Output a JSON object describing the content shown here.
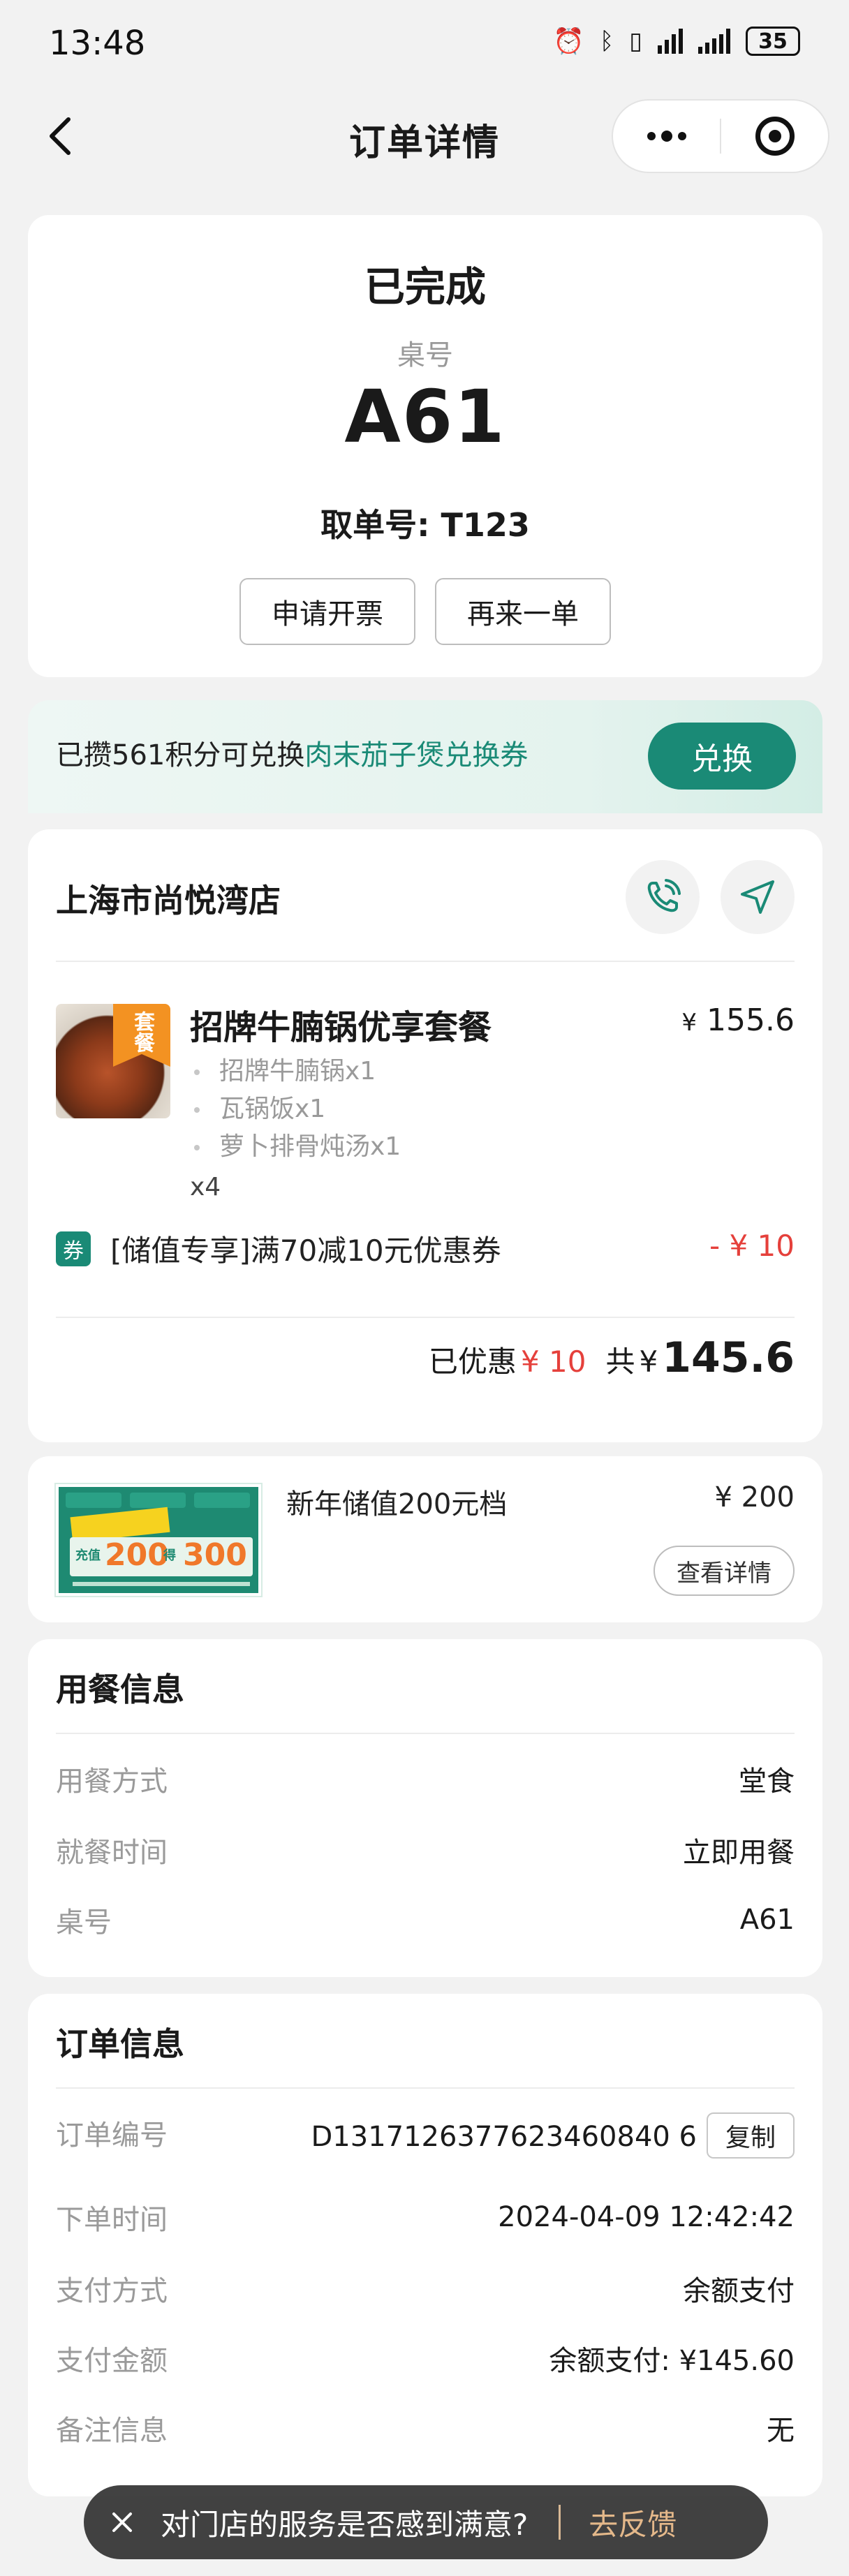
{
  "status_bar": {
    "time": "13:48",
    "battery": "35"
  },
  "nav": {
    "title": "订单详情"
  },
  "order_status": {
    "title": "已完成",
    "table_label": "桌号",
    "table_number": "A61",
    "pickup": "取单号: T123",
    "buttons": [
      "申请开票",
      "再来一单"
    ]
  },
  "points": {
    "prefix": "已攒561积分可兑换",
    "highlight": "肉末茄子煲兑换券",
    "button": "兑换"
  },
  "store": {
    "name": "上海市尚悦湾店",
    "item": {
      "badge": "套餐",
      "name": "招牌牛腩锅优享套餐",
      "currency": "¥",
      "price": "155.6",
      "sub_items": [
        "招牌牛腩锅x1",
        "瓦锅饭x1",
        "萝卜排骨炖汤x1"
      ],
      "quantity": "x4"
    },
    "coupon": {
      "tag": "券",
      "name": "[储值专享]满70减10元优惠券",
      "amount": "- ¥ 10"
    },
    "summary": {
      "discount_label": "已优惠",
      "discount_value": "¥ 10",
      "total_label": "共",
      "currency": "¥",
      "total": "145.6"
    }
  },
  "recharge": {
    "promo_image": {
      "n1": "200",
      "n2": "300",
      "l1": "充值",
      "l2": "得"
    },
    "name": "新年储值200元档",
    "price": "¥ 200",
    "button": "查看详情"
  },
  "dining_info": {
    "title": "用餐信息",
    "rows": [
      {
        "label": "用餐方式",
        "value": "堂食"
      },
      {
        "label": "就餐时间",
        "value": "立即用餐"
      },
      {
        "label": "桌号",
        "value": "A61"
      }
    ]
  },
  "order_info": {
    "title": "订单信息",
    "copy_button": "复制",
    "rows": [
      {
        "label": "订单编号",
        "value": "D1317126377623460840 6"
      },
      {
        "label": "下单时间",
        "value": "2024-04-09 12:42:42"
      },
      {
        "label": "支付方式",
        "value": "余额支付"
      },
      {
        "label": "支付金额",
        "value": "余额支付: ¥145.60"
      },
      {
        "label": "备注信息",
        "value": "无"
      }
    ]
  },
  "toast": {
    "question": "对门店的服务是否感到满意?",
    "action": "去反馈"
  },
  "colors": {
    "brand_green": "#1a8a76",
    "price_red": "#e5403b",
    "feedback_gold": "#e4b88a"
  }
}
